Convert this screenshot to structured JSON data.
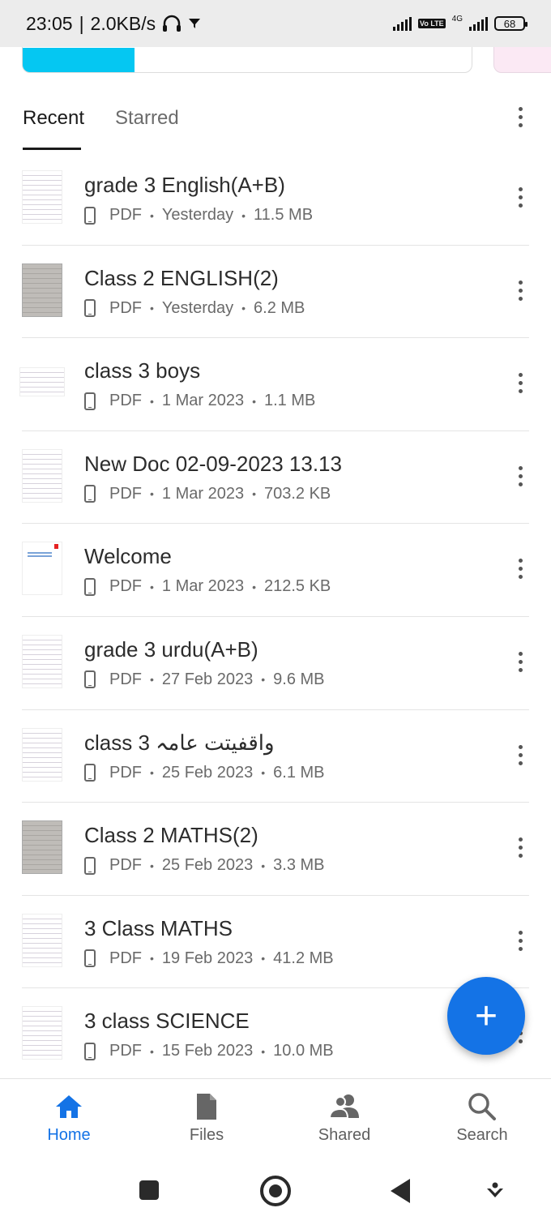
{
  "status_bar": {
    "time": "23:05",
    "network_speed": "2.0KB/s",
    "signal_label": "4G",
    "volte": "Vo LTE",
    "battery": "68"
  },
  "tabs": [
    {
      "label": "Recent",
      "active": true
    },
    {
      "label": "Starred",
      "active": false
    }
  ],
  "files": [
    {
      "name": "grade 3 English(A+B)",
      "type": "PDF",
      "date": "Yesterday",
      "size": "11.5 MB"
    },
    {
      "name": "Class 2 ENGLISH(2)",
      "type": "PDF",
      "date": "Yesterday",
      "size": "6.2 MB"
    },
    {
      "name": "class 3 boys",
      "type": "PDF",
      "date": "1 Mar 2023",
      "size": "1.1 MB"
    },
    {
      "name": "New Doc 02-09-2023 13.13",
      "type": "PDF",
      "date": "1 Mar 2023",
      "size": "703.2 KB"
    },
    {
      "name": "Welcome",
      "type": "PDF",
      "date": "1 Mar 2023",
      "size": "212.5 KB"
    },
    {
      "name": "grade 3 urdu(A+B)",
      "type": "PDF",
      "date": "27 Feb 2023",
      "size": "9.6 MB"
    },
    {
      "name": "class 3 واقفیتت عامہ",
      "type": "PDF",
      "date": "25 Feb 2023",
      "size": "6.1 MB"
    },
    {
      "name": "Class 2 MATHS(2)",
      "type": "PDF",
      "date": "25 Feb 2023",
      "size": "3.3 MB"
    },
    {
      "name": "3 Class MATHS",
      "type": "PDF",
      "date": "19 Feb 2023",
      "size": "41.2 MB"
    },
    {
      "name": "3 class SCIENCE",
      "type": "PDF",
      "date": "15 Feb 2023",
      "size": "10.0 MB"
    }
  ],
  "fab": {
    "icon": "plus-icon",
    "label": "+"
  },
  "bottom_nav": [
    {
      "label": "Home",
      "icon": "home-icon",
      "active": true
    },
    {
      "label": "Files",
      "icon": "file-icon",
      "active": false
    },
    {
      "label": "Shared",
      "icon": "people-icon",
      "active": false
    },
    {
      "label": "Search",
      "icon": "search-icon",
      "active": false
    }
  ],
  "colors": {
    "accent": "#1473e6",
    "card_fill": "#05c7f2",
    "card_pink": "#fbe9f4"
  }
}
